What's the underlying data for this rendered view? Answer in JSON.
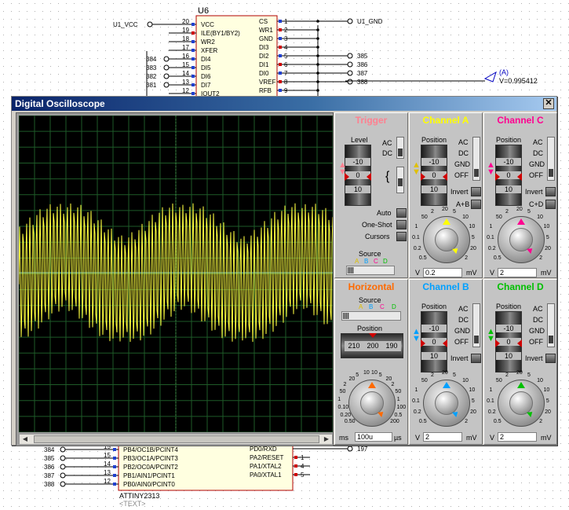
{
  "schematic": {
    "top_chip": {
      "ref": "U6",
      "left_pins": [
        {
          "num": "20",
          "name": "VCC",
          "net": "U1_VCC"
        },
        {
          "num": "19",
          "name": "ILE(BY1/BY2)"
        },
        {
          "num": "18",
          "name": "WR2"
        },
        {
          "num": "17",
          "name": "XFER"
        },
        {
          "num": "16",
          "name": "DI4",
          "net": "384"
        },
        {
          "num": "15",
          "name": "DI5",
          "net": "383"
        },
        {
          "num": "14",
          "name": "DI6",
          "net": "382"
        },
        {
          "num": "13",
          "name": "DI7",
          "net": "381"
        },
        {
          "num": "12",
          "name": "IOUT2"
        }
      ],
      "right_pins": [
        {
          "num": "1",
          "name": "CS",
          "net": "U1_GND"
        },
        {
          "num": "2",
          "name": "WR1"
        },
        {
          "num": "3",
          "name": "GND"
        },
        {
          "num": "4",
          "name": "DI3"
        },
        {
          "num": "5",
          "name": "DI2",
          "net": "385"
        },
        {
          "num": "6",
          "name": "DI1",
          "net": "386"
        },
        {
          "num": "7",
          "name": "DI0",
          "net": "387"
        },
        {
          "num": "8",
          "name": "VREF",
          "net": "388"
        },
        {
          "num": "9",
          "name": "RFB"
        }
      ]
    },
    "voltage_probe": {
      "label": "(A)",
      "value": "V=0.995412"
    },
    "bottom_chip": {
      "ref": "ATTINY2313",
      "text": "<TEXT>",
      "left_pins": [
        {
          "num": "15",
          "name": "PB4/OC1B/PCINT4",
          "net": "384"
        },
        {
          "num": "15",
          "name": "PB3/OC1A/PCINT3",
          "net": "385"
        },
        {
          "num": "14",
          "name": "PB2/OC0A/PCINT2",
          "net": "386"
        },
        {
          "num": "13",
          "name": "PB1/AIN1/PCINT1",
          "net": "387"
        },
        {
          "num": "12",
          "name": "PB0/AIN0/PCINT0",
          "net": "388"
        }
      ],
      "right_pins": [
        {
          "num": "",
          "name": "PD0/RXD",
          "net": "197"
        },
        {
          "num": "1",
          "name": "PA2/RESET"
        },
        {
          "num": "4",
          "name": "PA1/XTAL2"
        },
        {
          "num": "5",
          "name": "PA0/XTAL1"
        }
      ]
    }
  },
  "oscilloscope": {
    "title": "Digital Oscilloscope",
    "close": "✕",
    "trigger": {
      "title": "Trigger",
      "level_label": "Level",
      "scale": [
        "-10",
        "0",
        "10"
      ],
      "coupling": [
        "AC",
        "DC"
      ],
      "modes": [
        "Auto",
        "One-Shot",
        "Cursors"
      ],
      "source_label": "Source",
      "sources": [
        "A",
        "B",
        "C",
        "D"
      ]
    },
    "channels": [
      {
        "id": "A",
        "title": "Channel A",
        "color": "#ffff00",
        "position_label": "Position",
        "scale": [
          "-10",
          "0",
          "10"
        ],
        "coupling": [
          "AC",
          "DC",
          "GND",
          "OFF"
        ],
        "options": [
          "Invert",
          "A+B"
        ],
        "knob_ticks": [
          "0.5",
          "0.2",
          "0.1",
          "1",
          "50",
          "2",
          "20",
          "5",
          "10",
          "10",
          "5",
          "20",
          "2"
        ],
        "value": "0.2",
        "unit_left": "V",
        "unit_right": "mV"
      },
      {
        "id": "C",
        "title": "Channel C",
        "color": "#ff0090",
        "position_label": "Position",
        "scale": [
          "-10",
          "0",
          "10"
        ],
        "coupling": [
          "AC",
          "DC",
          "GND",
          "OFF"
        ],
        "options": [
          "Invert",
          "C+D"
        ],
        "knob_ticks": [
          "0.5",
          "0.2",
          "0.1",
          "1",
          "50",
          "2",
          "20",
          "5",
          "10",
          "10",
          "5",
          "20",
          "2"
        ],
        "value": "2",
        "unit_left": "V",
        "unit_right": "mV"
      },
      {
        "id": "B",
        "title": "Channel B",
        "color": "#00a0ff",
        "position_label": "Position",
        "scale": [
          "-10",
          "0",
          "10"
        ],
        "coupling": [
          "AC",
          "DC",
          "GND",
          "OFF"
        ],
        "options": [
          "Invert"
        ],
        "knob_ticks": [
          "0.5",
          "0.2",
          "0.1",
          "1",
          "50",
          "2",
          "20",
          "5",
          "10",
          "10",
          "5",
          "20",
          "2"
        ],
        "value": "2",
        "unit_left": "V",
        "unit_right": "mV"
      },
      {
        "id": "D",
        "title": "Channel D",
        "color": "#00c000",
        "position_label": "Position",
        "scale": [
          "-10",
          "0",
          "10"
        ],
        "coupling": [
          "AC",
          "DC",
          "GND",
          "OFF"
        ],
        "options": [
          "Invert"
        ],
        "knob_ticks": [
          "0.5",
          "0.2",
          "0.1",
          "1",
          "50",
          "2",
          "20",
          "5",
          "10",
          "10",
          "5",
          "20",
          "2"
        ],
        "value": "2",
        "unit_left": "V",
        "unit_right": "mV"
      }
    ],
    "horizontal": {
      "title": "Horizontal",
      "color": "#ff6a00",
      "source_label": "Source",
      "sources": [
        "A",
        "B",
        "C",
        "D"
      ],
      "position_label": "Position",
      "position_values": [
        "210",
        "200",
        "190"
      ],
      "knob_ticks": [
        "0.50",
        "0.20",
        "0.10",
        "1",
        "50",
        "2",
        "20",
        "5",
        "10",
        "10",
        "5",
        "20",
        "2",
        "50",
        "1",
        "100",
        "0.5",
        "200"
      ],
      "value": "100u",
      "unit_left": "ms",
      "unit_right": "µs"
    }
  }
}
